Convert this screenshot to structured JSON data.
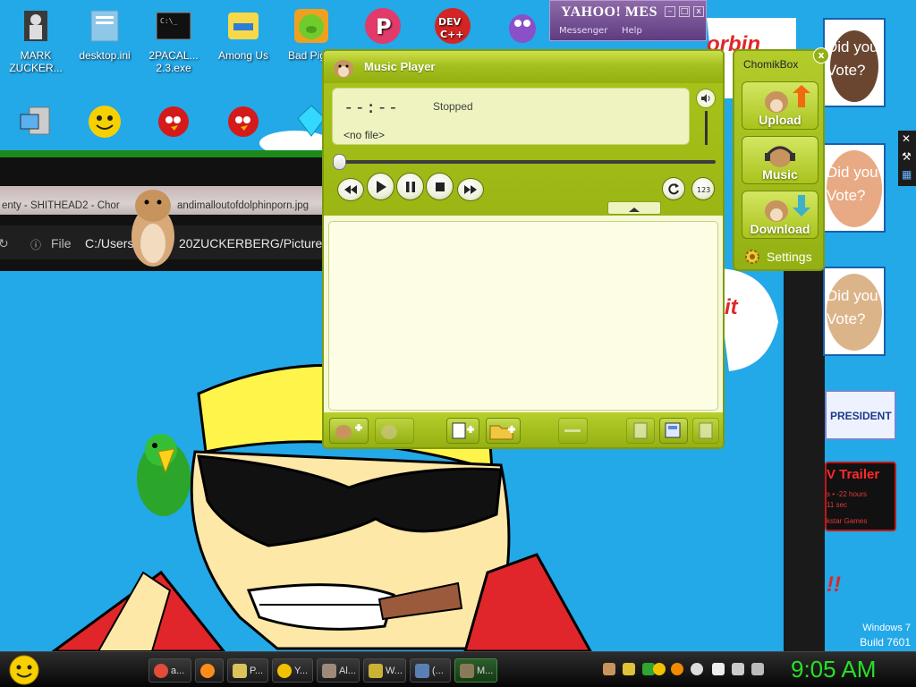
{
  "desktop": {
    "icons": [
      {
        "label": "MARK\nZUCKER...",
        "icon": "user-folder-icon"
      },
      {
        "label": "desktop.ini",
        "icon": "settings-file-icon"
      },
      {
        "label": "2PACAL...\n2.3.exe",
        "icon": "console-icon"
      },
      {
        "label": "Among Us",
        "icon": "game-icon"
      },
      {
        "label": "Bad Pig...",
        "icon": "pig-icon"
      },
      {
        "label": "",
        "icon": "pinball-icon"
      },
      {
        "label": "",
        "icon": "devcpp-icon"
      },
      {
        "label": "",
        "icon": "purple-creature-icon"
      }
    ],
    "icons_row2": [
      {
        "label": "",
        "icon": "computer-icon"
      },
      {
        "label": "",
        "icon": "yahoo-icon"
      },
      {
        "label": "",
        "icon": "angry-bird-icon"
      },
      {
        "label": "",
        "icon": "angry-bird-icon"
      },
      {
        "label": "",
        "icon": "gem-icon"
      }
    ]
  },
  "browser": {
    "tab_left_text": "enty - SHITHEAD2 - Chor",
    "tab_right_text": "andimalloutofdolphinporn.jpg",
    "address_label": "File",
    "address_left": "C:/Users",
    "address_right": "20ZUCKERBERG/Pictures/"
  },
  "yahoo": {
    "title": "YAHOO! MES",
    "menu": [
      "Messenger",
      "Help"
    ]
  },
  "ads": {
    "vote_text_1": "Did you\nVote?",
    "vote_text_2": "Did you\nVote?",
    "vote_text_3": "Did you\nVote?",
    "banner_red_top": "orbin",
    "banner_red_mid": "it",
    "president_label": "PRESIDENT",
    "trailer_label": "V Trailer",
    "trailer_sub1": "s • -22 hours",
    "trailer_sub2": "11 sec",
    "trailer_sub3": "kstar Games",
    "exclaim": "!!"
  },
  "music_player": {
    "title": "Music Player",
    "time": "--:--",
    "status": "Stopped",
    "file": "<no file>",
    "controls": [
      "rewind",
      "play",
      "pause",
      "stop",
      "forward",
      "repeat",
      "shuffle"
    ]
  },
  "chomikbox": {
    "title": "ChomikBox",
    "close": "x",
    "buttons": [
      "Upload",
      "Music",
      "Download"
    ],
    "settings": "Settings"
  },
  "watermark": {
    "line1": "Windows 7",
    "line2": "Build 7601"
  },
  "taskbar": {
    "items": [
      {
        "label": "a...",
        "color": "#e24c3b"
      },
      {
        "label": "",
        "color": "#ff8c1a"
      },
      {
        "label": "P...",
        "color": "#d9c35a"
      },
      {
        "label": "Y...",
        "color": "#f2c200"
      },
      {
        "label": "Al...",
        "color": "#9e8a7a"
      },
      {
        "label": "W...",
        "color": "#c9b236"
      },
      {
        "label": "(...",
        "color": "#5a7fb5"
      },
      {
        "label": "M...",
        "color": "#8a7a5a"
      }
    ],
    "clock": "9:05 AM"
  },
  "colors": {
    "wallpaper": "#23a8e8",
    "player_green": "#9bb614",
    "clock_green": "#27e027"
  }
}
